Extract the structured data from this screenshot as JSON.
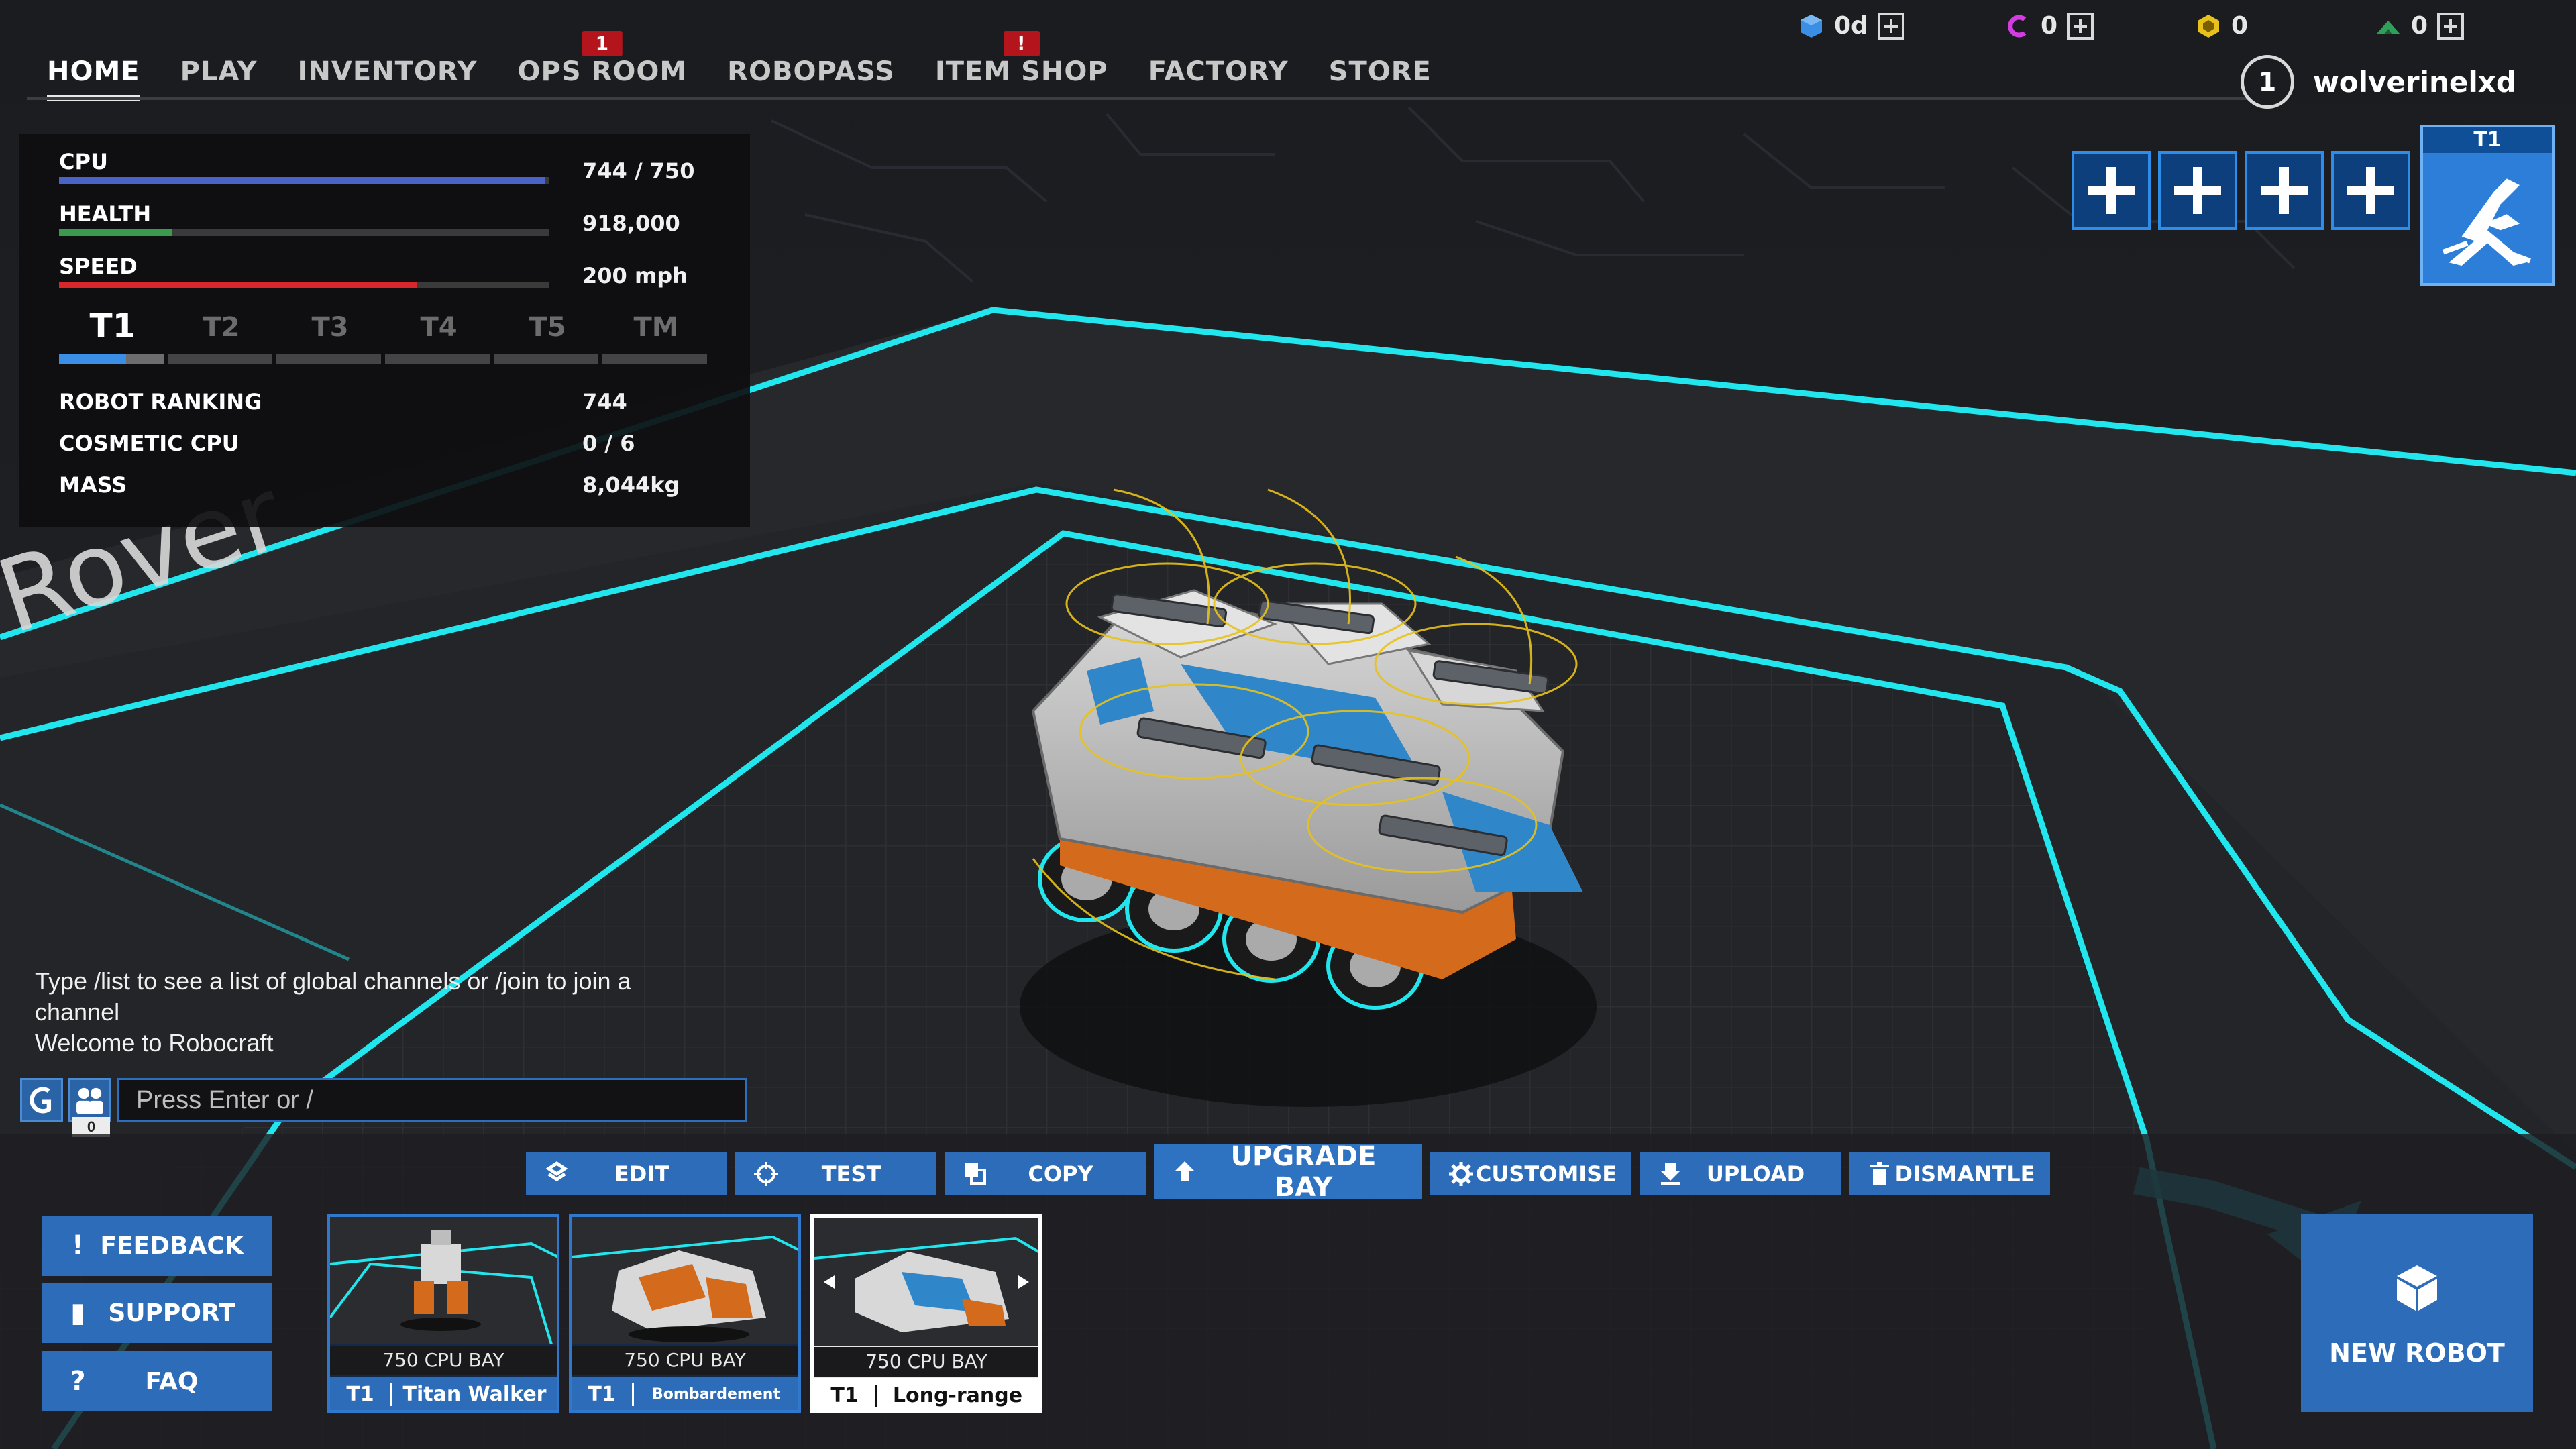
{
  "nav": {
    "tabs": [
      {
        "label": "HOME",
        "active": true
      },
      {
        "label": "PLAY"
      },
      {
        "label": "INVENTORY"
      },
      {
        "label": "OPS ROOM",
        "badge": "1"
      },
      {
        "label": "ROBOPASS"
      },
      {
        "label": "ITEM SHOP",
        "badge": "!"
      },
      {
        "label": "FACTORY"
      },
      {
        "label": "STORE"
      }
    ]
  },
  "currencies": [
    {
      "icon": "cube-icon",
      "value": "0d",
      "color": "#3b8ee6"
    },
    {
      "icon": "cosmetic-credit-icon",
      "value": "0",
      "color": "#d43be0"
    },
    {
      "icon": "robits-icon",
      "value": "0",
      "color": "#e8c21a"
    },
    {
      "icon": "garage-slot-icon",
      "value": "0",
      "color": "#2fa05a"
    }
  ],
  "user": {
    "level": "1",
    "name": "wolverinelxd"
  },
  "stats": {
    "cpu": {
      "label": "CPU",
      "value": "744 / 750",
      "fraction": 0.992,
      "color": "#4a63c9"
    },
    "health": {
      "label": "HEALTH",
      "value": "918,000",
      "fraction": 0.23,
      "color": "#3a9a4e"
    },
    "speed": {
      "label": "SPEED",
      "value": "200 mph",
      "fraction": 0.73,
      "color": "#d8272a"
    },
    "tiers": [
      "T1",
      "T2",
      "T3",
      "T4",
      "T5",
      "TM"
    ],
    "active_tier": "T1",
    "rows": [
      {
        "label": "ROBOT RANKING",
        "value": "744"
      },
      {
        "label": "COSMETIC CPU",
        "value": "0 / 6"
      },
      {
        "label": "MASS",
        "value": "8,044kg"
      }
    ]
  },
  "floor_text": "Rover",
  "tier_badge": {
    "label": "T1"
  },
  "chat": {
    "messages": [
      "Type /list to see a list of global channels or /join to join a channel",
      "Welcome to Robocraft"
    ],
    "placeholder": "Press Enter or /",
    "member_count": "0"
  },
  "actions": [
    {
      "label": "EDIT",
      "icon": "edit-icon"
    },
    {
      "label": "TEST",
      "icon": "crosshair-icon"
    },
    {
      "label": "COPY",
      "icon": "copy-icon"
    },
    {
      "label": "UPGRADE BAY",
      "icon": "upload-arrow-icon"
    },
    {
      "label": "CUSTOMISE",
      "icon": "gear-icon"
    },
    {
      "label": "UPLOAD",
      "icon": "download-icon"
    },
    {
      "label": "DISMANTLE",
      "icon": "trash-icon"
    }
  ],
  "side_buttons": [
    {
      "label": "FEEDBACK",
      "icon": "!"
    },
    {
      "label": "SUPPORT",
      "icon": "▮"
    },
    {
      "label": "FAQ",
      "icon": "?"
    }
  ],
  "robots": [
    {
      "bay": "750 CPU BAY",
      "tier": "T1",
      "name": "Titan Walker"
    },
    {
      "bay": "750 CPU BAY",
      "tier": "T1",
      "name": "Bombardement Hover"
    },
    {
      "bay": "750 CPU BAY",
      "tier": "T1",
      "name": "Long-range Rover",
      "selected": true
    }
  ],
  "new_robot": {
    "label": "NEW ROBOT"
  },
  "colors": {
    "accent": "#2c6cb8",
    "neon": "#22e6ee",
    "badge_red": "#b4141b"
  }
}
